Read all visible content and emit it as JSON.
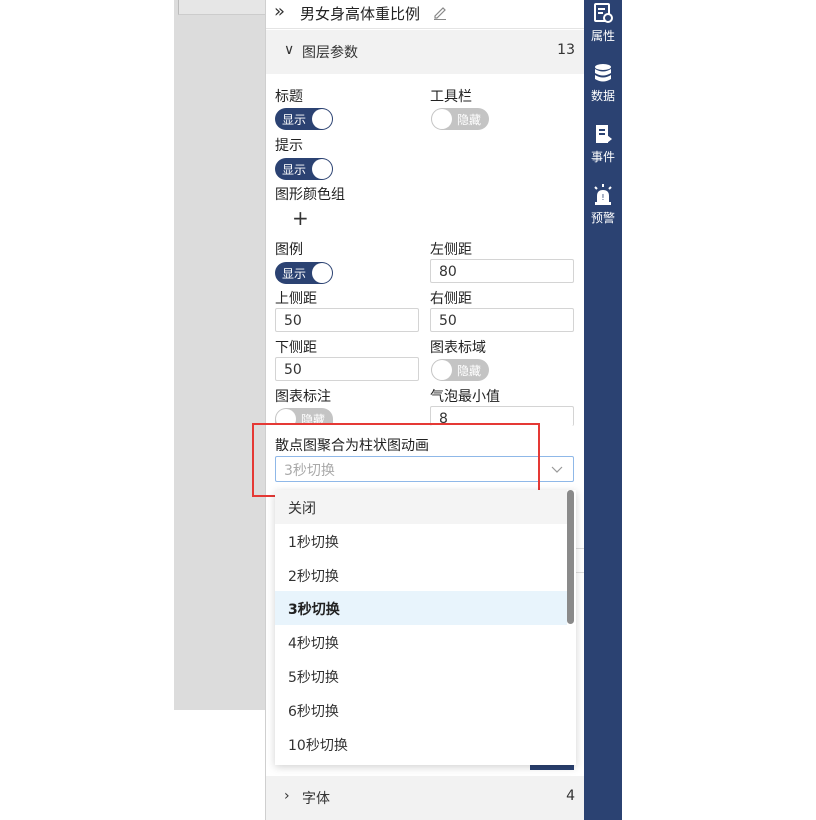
{
  "panel": {
    "title": "男女身高体重比例"
  },
  "sections": {
    "layer_params": {
      "label": "图层参数",
      "count": "13"
    },
    "font": {
      "label": "字体",
      "count": "4"
    }
  },
  "fields": {
    "title": {
      "label": "标题",
      "toggle": "显示"
    },
    "toolbar": {
      "label": "工具栏",
      "toggle": "隐藏"
    },
    "tooltip": {
      "label": "提示",
      "toggle": "显示"
    },
    "color_group": {
      "label": "图形颜色组"
    },
    "legend": {
      "label": "图例",
      "toggle": "显示"
    },
    "left_margin": {
      "label": "左侧距",
      "value": "80"
    },
    "top_margin": {
      "label": "上侧距",
      "value": "50"
    },
    "right_margin": {
      "label": "右侧距",
      "value": "50"
    },
    "bottom_margin": {
      "label": "下侧距",
      "value": "50"
    },
    "mark_area": {
      "label": "图表标域",
      "toggle": "隐藏"
    },
    "mark_point": {
      "label": "图表标注",
      "toggle": "隐藏"
    },
    "bubble_min": {
      "label": "气泡最小值",
      "value": "8"
    },
    "animation": {
      "label": "散点图聚合为柱状图动画",
      "value": "3秒切换"
    }
  },
  "dropdown": {
    "options": [
      "关闭",
      "1秒切换",
      "2秒切换",
      "3秒切换",
      "4秒切换",
      "5秒切换",
      "6秒切换",
      "10秒切换"
    ],
    "selected_index": 3
  },
  "side_nav": [
    {
      "label": "属性",
      "icon": "properties-icon"
    },
    {
      "label": "数据",
      "icon": "database-icon"
    },
    {
      "label": "事件",
      "icon": "event-icon"
    },
    {
      "label": "预警",
      "icon": "alarm-icon"
    }
  ],
  "colors": {
    "nav_bg": "#2b4272",
    "toggle_on": "#2b4272",
    "toggle_off": "#c4c4c4",
    "highlight": "#e53935",
    "selected_option_bg": "#e8f4fc"
  }
}
